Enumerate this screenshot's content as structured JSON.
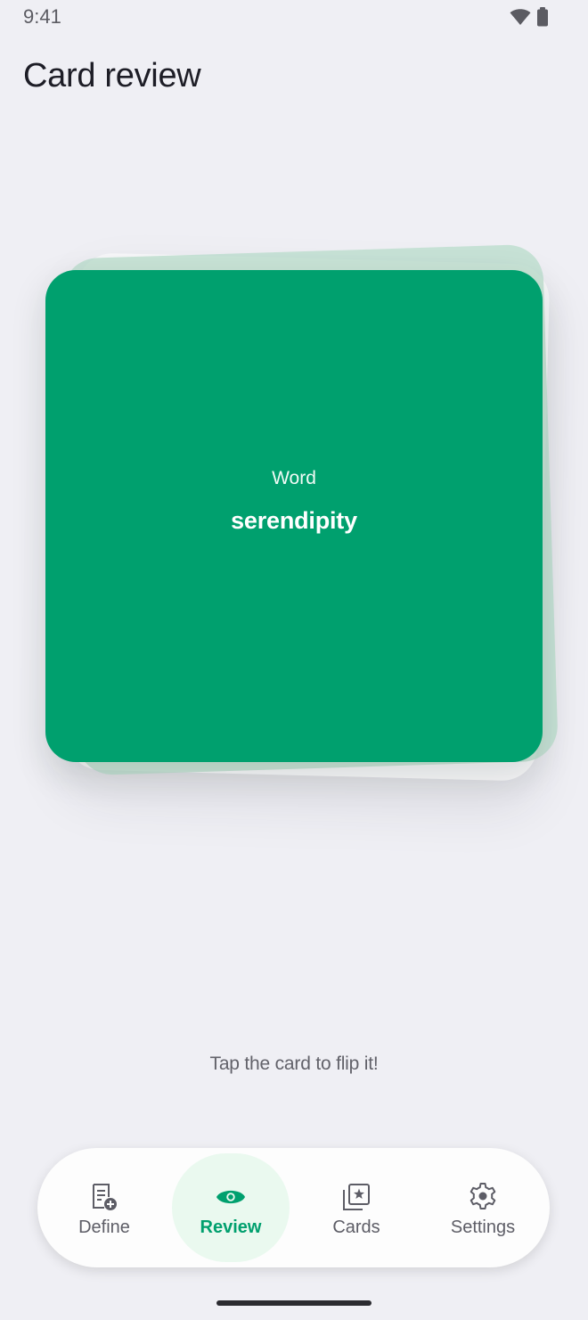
{
  "status": {
    "time": "9:41",
    "icons": [
      "wifi-icon",
      "battery-icon"
    ]
  },
  "page": {
    "title": "Card review"
  },
  "card": {
    "label": "Word",
    "word": "serendipity",
    "color": "#00a06e"
  },
  "hint": "Tap the card to flip it!",
  "nav": {
    "active": "review",
    "items": [
      {
        "key": "define",
        "label": "Define",
        "icon": "define-note-add-icon"
      },
      {
        "key": "review",
        "label": "Review",
        "icon": "eye-icon"
      },
      {
        "key": "cards",
        "label": "Cards",
        "icon": "star-cards-icon"
      },
      {
        "key": "settings",
        "label": "Settings",
        "icon": "gear-icon"
      }
    ],
    "accent": "#00a06e",
    "active_bg": "#eaf9ef"
  }
}
